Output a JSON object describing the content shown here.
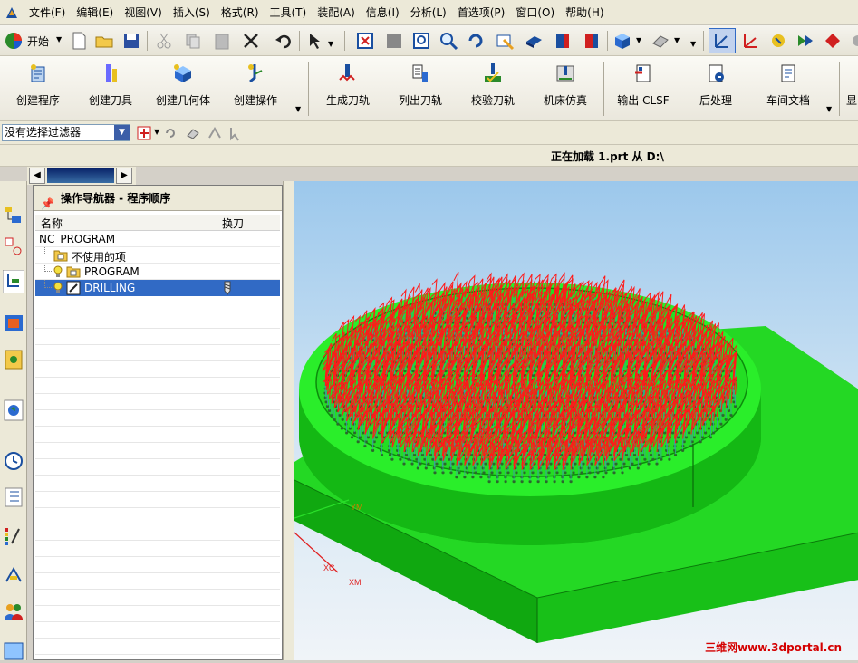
{
  "menubar": {
    "items": [
      "文件(F)",
      "编辑(E)",
      "视图(V)",
      "插入(S)",
      "格式(R)",
      "工具(T)",
      "装配(A)",
      "信息(I)",
      "分析(L)",
      "首选项(P)",
      "窗口(O)",
      "帮助(H)"
    ]
  },
  "toolbar1": {
    "start_label": "开始"
  },
  "toolbar2": {
    "buttons": [
      "创建程序",
      "创建刀具",
      "创建几何体",
      "创建操作",
      "生成刀轨",
      "列出刀轨",
      "校验刀轨",
      "机床仿真",
      "输出 CLSF",
      "后处理",
      "车间文档",
      "显"
    ]
  },
  "filter": {
    "value": "没有选择过滤器"
  },
  "status": {
    "text": "正在加载 1.prt 从 D:\\"
  },
  "navigator": {
    "title": "操作导航器 - 程序顺序",
    "columns": [
      "名称",
      "换刀"
    ],
    "rows": [
      {
        "name": "NC_PROGRAM"
      },
      {
        "name": "不使用的项"
      },
      {
        "name": "PROGRAM"
      },
      {
        "name": "DRILLING",
        "selected": true
      }
    ]
  },
  "viewport": {
    "axis_labels": {
      "ym": "YM",
      "xc": "XC",
      "xm": "XM"
    },
    "watermark": "三维网www.3dportal.cn"
  },
  "colors": {
    "model": "#1fe01f",
    "toolpath": "#ff1a1a",
    "selection": "#316ac5"
  }
}
